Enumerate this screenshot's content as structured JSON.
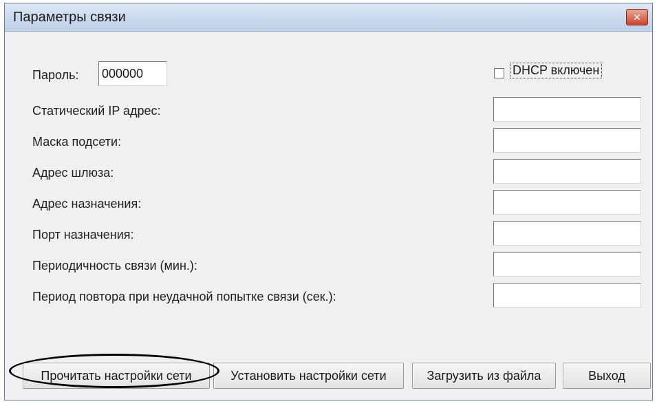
{
  "window": {
    "title": "Параметры связи"
  },
  "password": {
    "label": "Пароль:",
    "value": "000000"
  },
  "dhcp": {
    "label": "DHCP включен",
    "checked": false
  },
  "fields": [
    {
      "label": "Статический IP адрес:",
      "value": ""
    },
    {
      "label": "Маска подсети:",
      "value": ""
    },
    {
      "label": "Адрес шлюза:",
      "value": ""
    },
    {
      "label": "Адрес назначения:",
      "value": ""
    },
    {
      "label": "Порт назначения:",
      "value": ""
    },
    {
      "label": "Периодичность связи (мин.):",
      "value": ""
    },
    {
      "label": "Период повтора при неудачной попытке связи (сек.):",
      "value": ""
    }
  ],
  "buttons": {
    "read": "Прочитать настройки сети",
    "set": "Установить настройки сети",
    "load": "Загрузить из файла",
    "exit": "Выход"
  },
  "icons": {
    "close": "close-icon"
  },
  "colors": {
    "close_button": "#c8452f",
    "titlebar": "#cddbee"
  }
}
